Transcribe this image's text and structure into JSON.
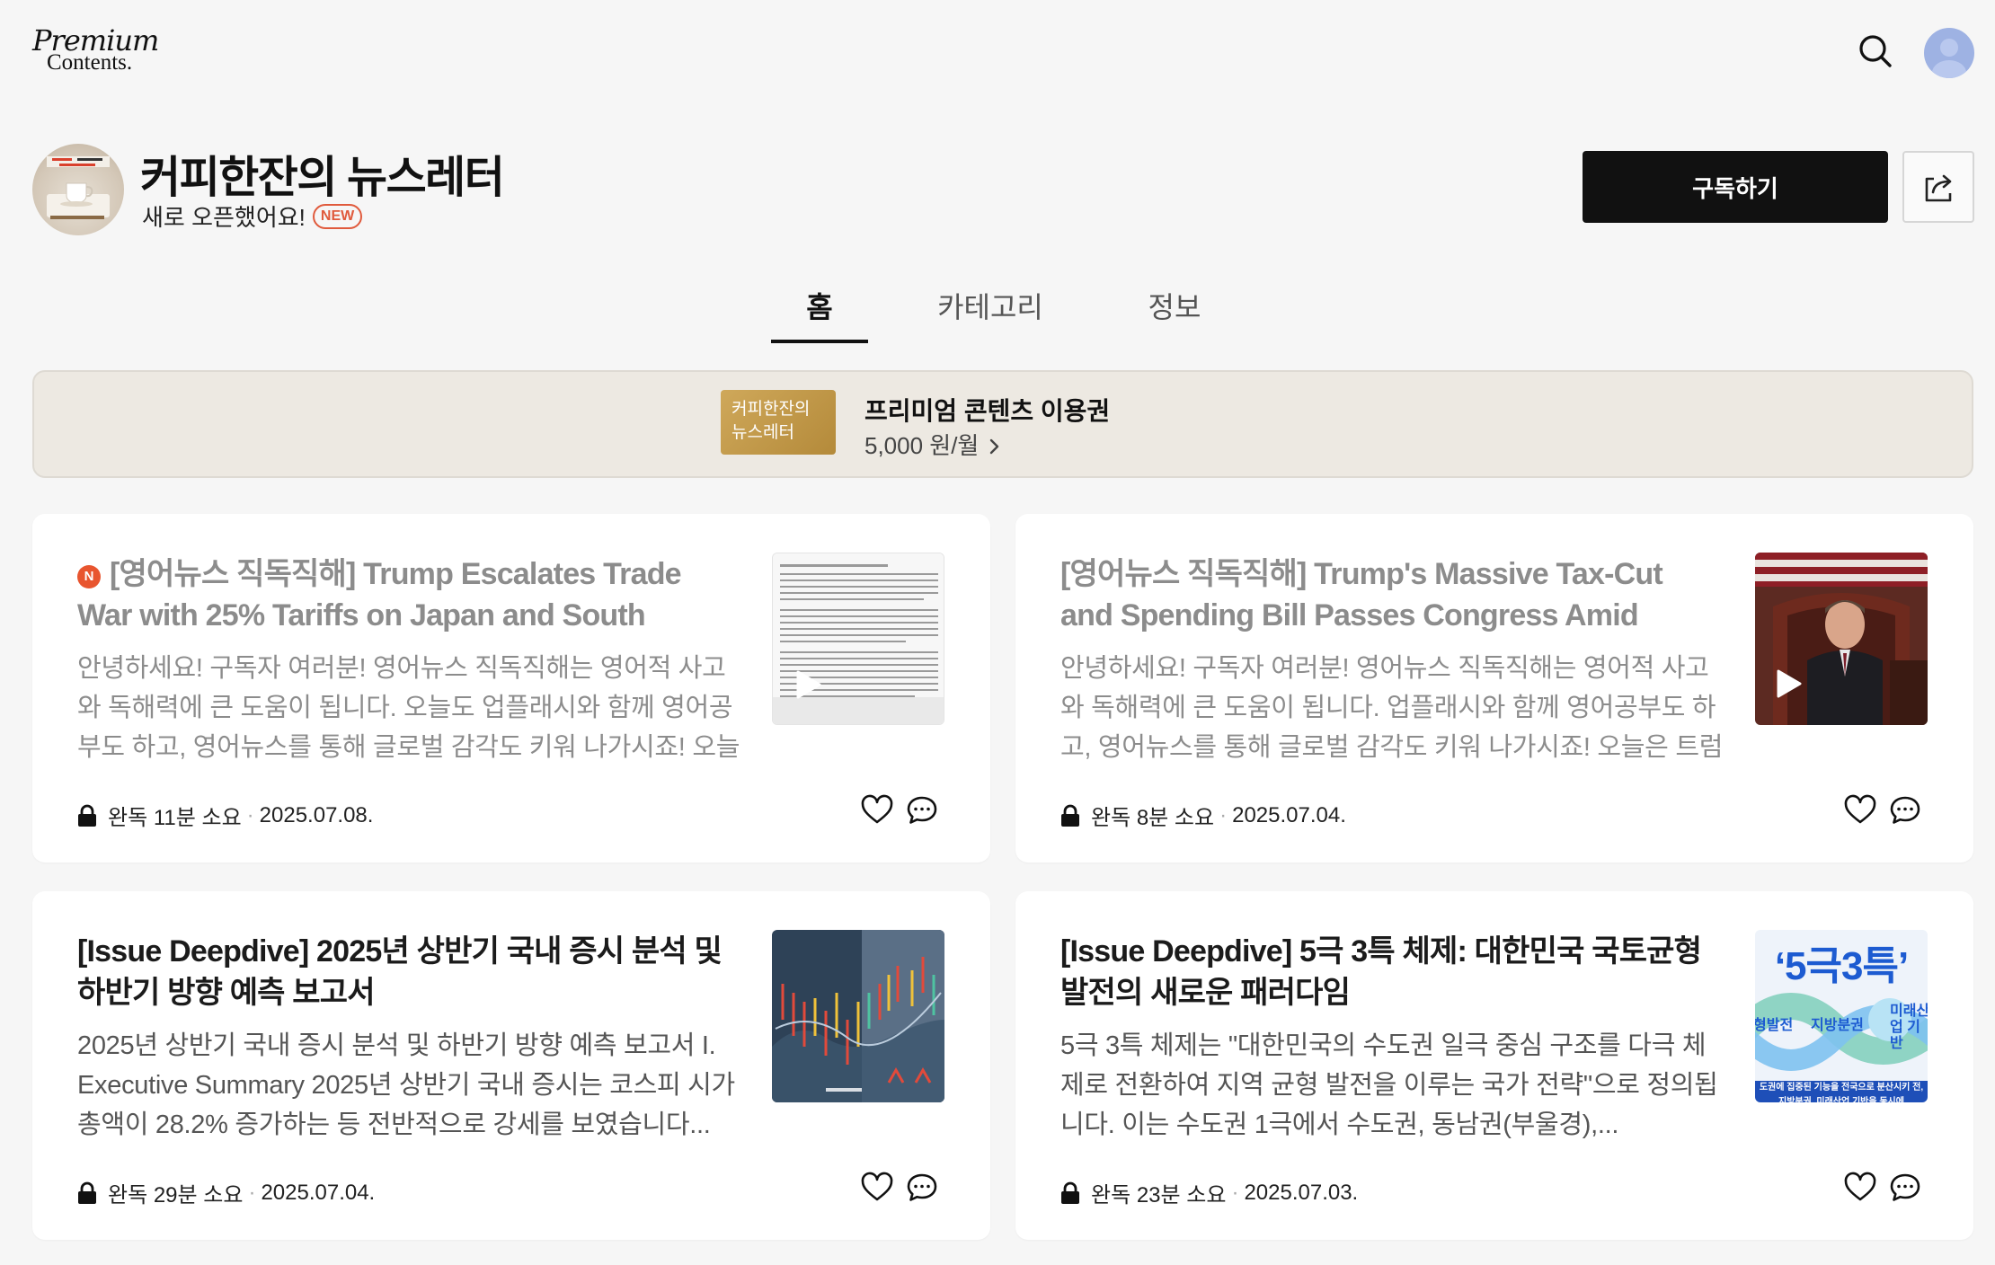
{
  "header": {
    "logo_line1": "Premium",
    "logo_line2": "Contents."
  },
  "channel": {
    "title": "커피한잔의 뉴스레터",
    "subtitle": "새로 오픈했어요!",
    "new_badge": "NEW",
    "subscribe_label": "구독하기"
  },
  "tabs": [
    {
      "label": "홈",
      "active": true
    },
    {
      "label": "카테고리",
      "active": false
    },
    {
      "label": "정보",
      "active": false
    }
  ],
  "banner": {
    "thumb_line1": "커피한잔의",
    "thumb_line2": "뉴스레터",
    "title": "프리미엄 콘텐츠 이용권",
    "price": "5,000 원/월"
  },
  "posts": [
    {
      "badge": "N",
      "title": "[영어뉴스 직독직해] Trump Escalates Trade War with 25% Tariffs on Japan and South Korea",
      "excerpt": "안녕하세요! 구독자 여러분! 영어뉴스 직독직해는 영어적 사고와 독해력에 큰 도움이 됩니다. 오늘도 업플래시와 함께 영어공부도 하고, 영어뉴스를 통해 글로벌 감각도 키워 나가시죠! 오늘은...",
      "status": "완독 11분 소요",
      "date": "2025.07.08.",
      "thumb_type": "document-video"
    },
    {
      "title": "[영어뉴스 직독직해] Trump's Massive Tax-Cut and Spending Bill Passes Congress Amid Partisan...",
      "excerpt": "안녕하세요! 구독자 여러분! 영어뉴스 직독직해는 영어적 사고와 독해력에 큰 도움이 됩니다. 업플래시와 함께 영어공부도 하고, 영어뉴스를 통해 글로벌 감각도 키워 나가시죠! 오늘은 트럼프...",
      "status": "완독 8분 소요",
      "date": "2025.07.04.",
      "thumb_type": "photo-video"
    },
    {
      "title": "[Issue Deepdive] 2025년 상반기 국내 증시 분석 및 하반기 방향 예측 보고서",
      "excerpt": "2025년 상반기 국내 증시 분석 및 하반기 방향 예측 보고서 I. Executive Summary 2025년 상반기 국내 증시는 코스피 시가총액이 28.2% 증가하는 등 전반적으로 강세를 보였습니다...",
      "status": "완독 29분 소요",
      "date": "2025.07.04.",
      "thumb_type": "stock-chart"
    },
    {
      "title": "[Issue Deepdive] 5극 3특 체제: 대한민국 국토균형발전의 새로운 패러다임",
      "excerpt": "5극 3특 체제는 \"대한민국의 수도권 일극 중심 구조를 다극 체제로 전환하여 지역 균형 발전을 이루는 국가 전략\"으로 정의됩니다. 이는 수도권 1극에서 수도권, 동남권(부울경),...",
      "status": "완독 23분 소요",
      "date": "2025.07.03.",
      "thumb_type": "infographic",
      "thumb_text": "‘5극3특’",
      "thumb_sub1": "형발전",
      "thumb_sub2": "지방분권",
      "thumb_sub3": "미래산업 기반",
      "thumb_foot": "도권에 집중된 기능을 전국으로 분산시키 전, 지방분권, 미래산업 기반을 동시에"
    }
  ],
  "colors": {
    "accent_new": "#e05a3c",
    "banner_bg": "#ede9e2",
    "banner_thumb": "#c49a4a",
    "subscribe_bg": "#111111"
  },
  "icons": [
    "search-icon",
    "avatar-icon",
    "share-icon",
    "lock-icon",
    "heart-icon",
    "comment-icon",
    "play-icon",
    "chevron-right-icon"
  ]
}
